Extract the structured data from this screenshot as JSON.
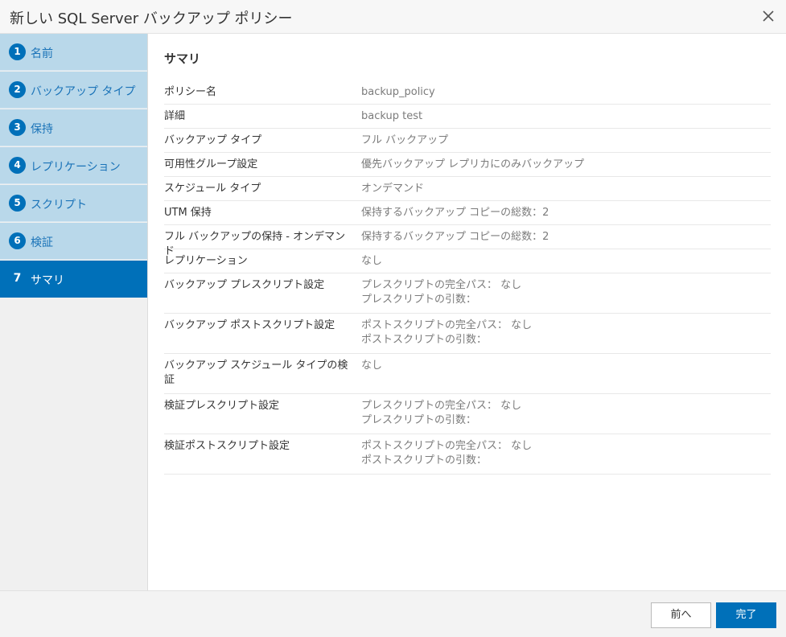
{
  "dialog": {
    "title": "新しい SQL Server バックアップ ポリシー"
  },
  "steps": [
    {
      "num": "1",
      "label": "名前"
    },
    {
      "num": "2",
      "label": "バックアップ タイプ"
    },
    {
      "num": "3",
      "label": "保持"
    },
    {
      "num": "4",
      "label": "レプリケーション"
    },
    {
      "num": "5",
      "label": "スクリプト"
    },
    {
      "num": "6",
      "label": "検証"
    },
    {
      "num": "7",
      "label": "サマリ"
    }
  ],
  "active_step": 7,
  "summary": {
    "heading": "サマリ",
    "rows": [
      {
        "key": "ポリシー名",
        "value": "backup_policy"
      },
      {
        "key": "詳細",
        "value": "backup test"
      },
      {
        "key": "バックアップ タイプ",
        "value": "フル バックアップ"
      },
      {
        "key": "可用性グループ設定",
        "value": "優先バックアップ レプリカにのみバックアップ"
      },
      {
        "key": "スケジュール タイプ",
        "value": "オンデマンド"
      },
      {
        "key": "UTM 保持",
        "value": "保持するバックアップ コピーの総数：2"
      },
      {
        "key": "フル バックアップの保持 - オンデマンド",
        "value": "保持するバックアップ コピーの総数：2"
      },
      {
        "key": "レプリケーション",
        "value": "なし"
      },
      {
        "key": "バックアップ プレスクリプト設定",
        "value": "プレスクリプトの完全パス： なし",
        "value2": "プレスクリプトの引数："
      },
      {
        "key": "バックアップ ポストスクリプト設定",
        "value": "ポストスクリプトの完全パス： なし",
        "value2": "ポストスクリプトの引数："
      },
      {
        "key": "バックアップ スケジュール タイプの検証",
        "value": "なし"
      },
      {
        "key": "検証プレスクリプト設定",
        "value": "プレスクリプトの完全パス： なし",
        "value2": "プレスクリプトの引数："
      },
      {
        "key": "検証ポストスクリプト設定",
        "value": "ポストスクリプトの完全パス： なし",
        "value2": "ポストスクリプトの引数："
      }
    ]
  },
  "footer": {
    "prev_label": "前へ",
    "finish_label": "完了"
  },
  "colors": {
    "accent": "#0070b9",
    "step_bg": "#b9d8ea",
    "step_text": "#1a73b8"
  },
  "icons": {
    "close": "close-icon"
  }
}
